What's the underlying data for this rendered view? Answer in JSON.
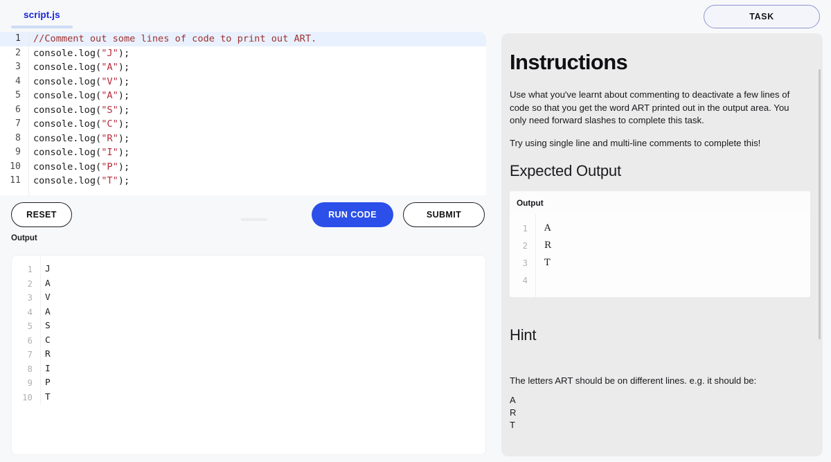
{
  "editor": {
    "tab_label": "script.js",
    "active_line": 1,
    "lines": [
      {
        "n": "1",
        "segments": [
          {
            "t": "//Comment out some lines of code to print out ART.",
            "k": "cmt"
          }
        ]
      },
      {
        "n": "2",
        "segments": [
          {
            "t": "console.log(",
            "k": "pl"
          },
          {
            "t": "\"J\"",
            "k": "str"
          },
          {
            "t": ");",
            "k": "pl"
          }
        ]
      },
      {
        "n": "3",
        "segments": [
          {
            "t": "console.log(",
            "k": "pl"
          },
          {
            "t": "\"A\"",
            "k": "str"
          },
          {
            "t": ");",
            "k": "pl"
          }
        ]
      },
      {
        "n": "4",
        "segments": [
          {
            "t": "console.log(",
            "k": "pl"
          },
          {
            "t": "\"V\"",
            "k": "str"
          },
          {
            "t": ");",
            "k": "pl"
          }
        ]
      },
      {
        "n": "5",
        "segments": [
          {
            "t": "console.log(",
            "k": "pl"
          },
          {
            "t": "\"A\"",
            "k": "str"
          },
          {
            "t": ");",
            "k": "pl"
          }
        ]
      },
      {
        "n": "6",
        "segments": [
          {
            "t": "console.log(",
            "k": "pl"
          },
          {
            "t": "\"S\"",
            "k": "str"
          },
          {
            "t": ");",
            "k": "pl"
          }
        ]
      },
      {
        "n": "7",
        "segments": [
          {
            "t": "console.log(",
            "k": "pl"
          },
          {
            "t": "\"C\"",
            "k": "str"
          },
          {
            "t": ");",
            "k": "pl"
          }
        ]
      },
      {
        "n": "8",
        "segments": [
          {
            "t": "console.log(",
            "k": "pl"
          },
          {
            "t": "\"R\"",
            "k": "str"
          },
          {
            "t": ");",
            "k": "pl"
          }
        ]
      },
      {
        "n": "9",
        "segments": [
          {
            "t": "console.log(",
            "k": "pl"
          },
          {
            "t": "\"I\"",
            "k": "str"
          },
          {
            "t": ");",
            "k": "pl"
          }
        ]
      },
      {
        "n": "10",
        "segments": [
          {
            "t": "console.log(",
            "k": "pl"
          },
          {
            "t": "\"P\"",
            "k": "str"
          },
          {
            "t": ");",
            "k": "pl"
          }
        ]
      },
      {
        "n": "11",
        "segments": [
          {
            "t": "console.log(",
            "k": "pl"
          },
          {
            "t": "\"T\"",
            "k": "str"
          },
          {
            "t": ");",
            "k": "pl"
          }
        ]
      }
    ]
  },
  "controls": {
    "reset_label": "RESET",
    "run_label": "RUN CODE",
    "submit_label": "SUBMIT",
    "run_color": "#2b4fe8"
  },
  "output": {
    "label": "Output",
    "lines": [
      {
        "n": "1",
        "text": "J"
      },
      {
        "n": "2",
        "text": "A"
      },
      {
        "n": "3",
        "text": "V"
      },
      {
        "n": "4",
        "text": "A"
      },
      {
        "n": "5",
        "text": "S"
      },
      {
        "n": "6",
        "text": "C"
      },
      {
        "n": "7",
        "text": "R"
      },
      {
        "n": "8",
        "text": "I"
      },
      {
        "n": "9",
        "text": "P"
      },
      {
        "n": "10",
        "text": "T"
      }
    ]
  },
  "task": {
    "button_label": "TASK"
  },
  "instructions": {
    "title": "Instructions",
    "paragraph_1": "Use what you've learnt about commenting to deactivate a few lines of code so that you get the word ART printed out in the output area. You only need forward slashes to complete this task.",
    "paragraph_2": "Try using single line and multi-line comments to complete this!",
    "expected_heading": "Expected Output",
    "expected_box_label": "Output",
    "expected_lines": [
      {
        "n": "1",
        "text": "A"
      },
      {
        "n": "2",
        "text": "R"
      },
      {
        "n": "3",
        "text": "T"
      },
      {
        "n": "4",
        "text": ""
      }
    ],
    "hint_heading": "Hint",
    "hint_text": "The letters ART should be on different lines. e.g. it should be:",
    "hint_example": [
      "A",
      "R",
      "T"
    ]
  }
}
